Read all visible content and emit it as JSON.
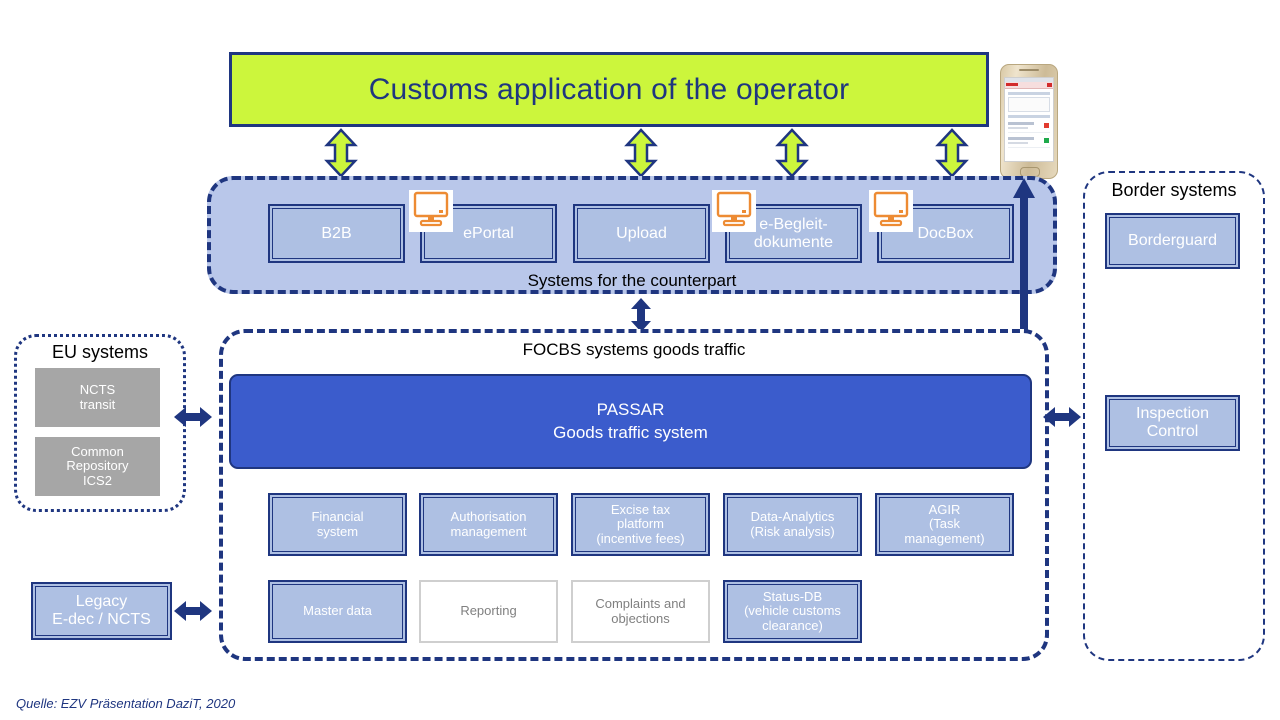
{
  "caption": "Quelle: EZV Präsentation DaziT, 2020",
  "banner": {
    "title": "Customs application of the operator"
  },
  "counterpart": {
    "label": "Systems for the counterpart",
    "boxes": [
      {
        "label": "B2B",
        "icon": null
      },
      {
        "label": "ePortal",
        "icon": "monitor-icon"
      },
      {
        "label": "Upload",
        "icon": null
      },
      {
        "label": "e-Begleit-\ndokumente",
        "icon": "monitor-icon"
      },
      {
        "label": "DocBox",
        "icon": "monitor-icon"
      }
    ]
  },
  "focbs": {
    "label": "FOCBS systems goods traffic",
    "passar": {
      "title": "PASSAR",
      "subtitle": "Goods traffic system"
    },
    "row1": [
      {
        "label": "Financial\nsystem",
        "style": "blue"
      },
      {
        "label": "Authorisation\nmanagement",
        "style": "blue"
      },
      {
        "label": "Excise tax\nplatform\n(incentive fees)",
        "style": "blue"
      },
      {
        "label": "Data-Analytics\n(Risk analysis)",
        "style": "blue"
      },
      {
        "label": "AGIR\n(Task\nmanagement)",
        "style": "blue"
      }
    ],
    "row2": [
      {
        "label": "Master data",
        "style": "blue"
      },
      {
        "label": "Reporting",
        "style": "white"
      },
      {
        "label": "Complaints and\nobjections",
        "style": "white"
      },
      {
        "label": "Status-DB\n(vehicle customs\nclearance)",
        "style": "blue"
      }
    ]
  },
  "eu_systems": {
    "label": "EU systems",
    "boxes": [
      {
        "label": "NCTS\ntransit",
        "style": "gray"
      },
      {
        "label": "Common\nRepository\nICS2",
        "style": "gray"
      }
    ]
  },
  "legacy": {
    "label": "Legacy\nE-dec / NCTS"
  },
  "border_systems": {
    "label": "Border systems",
    "boxes": [
      {
        "label": "Borderguard",
        "style": "blue"
      },
      {
        "label": "Inspection\nControl",
        "style": "blue"
      }
    ]
  },
  "phone": {
    "name": "mobile-app-preview"
  },
  "colors": {
    "banner_fill": "#ccf63c",
    "navy": "#1f3680",
    "panel_fill": "#b9c7ea",
    "box_fill": "#aec0e3",
    "passar_fill": "#3b5ccc",
    "gray_fill": "#a6a6a6",
    "white_box_border": "#cfcfcf",
    "white_box_text": "#808080",
    "caption_color": "#1f3680"
  }
}
